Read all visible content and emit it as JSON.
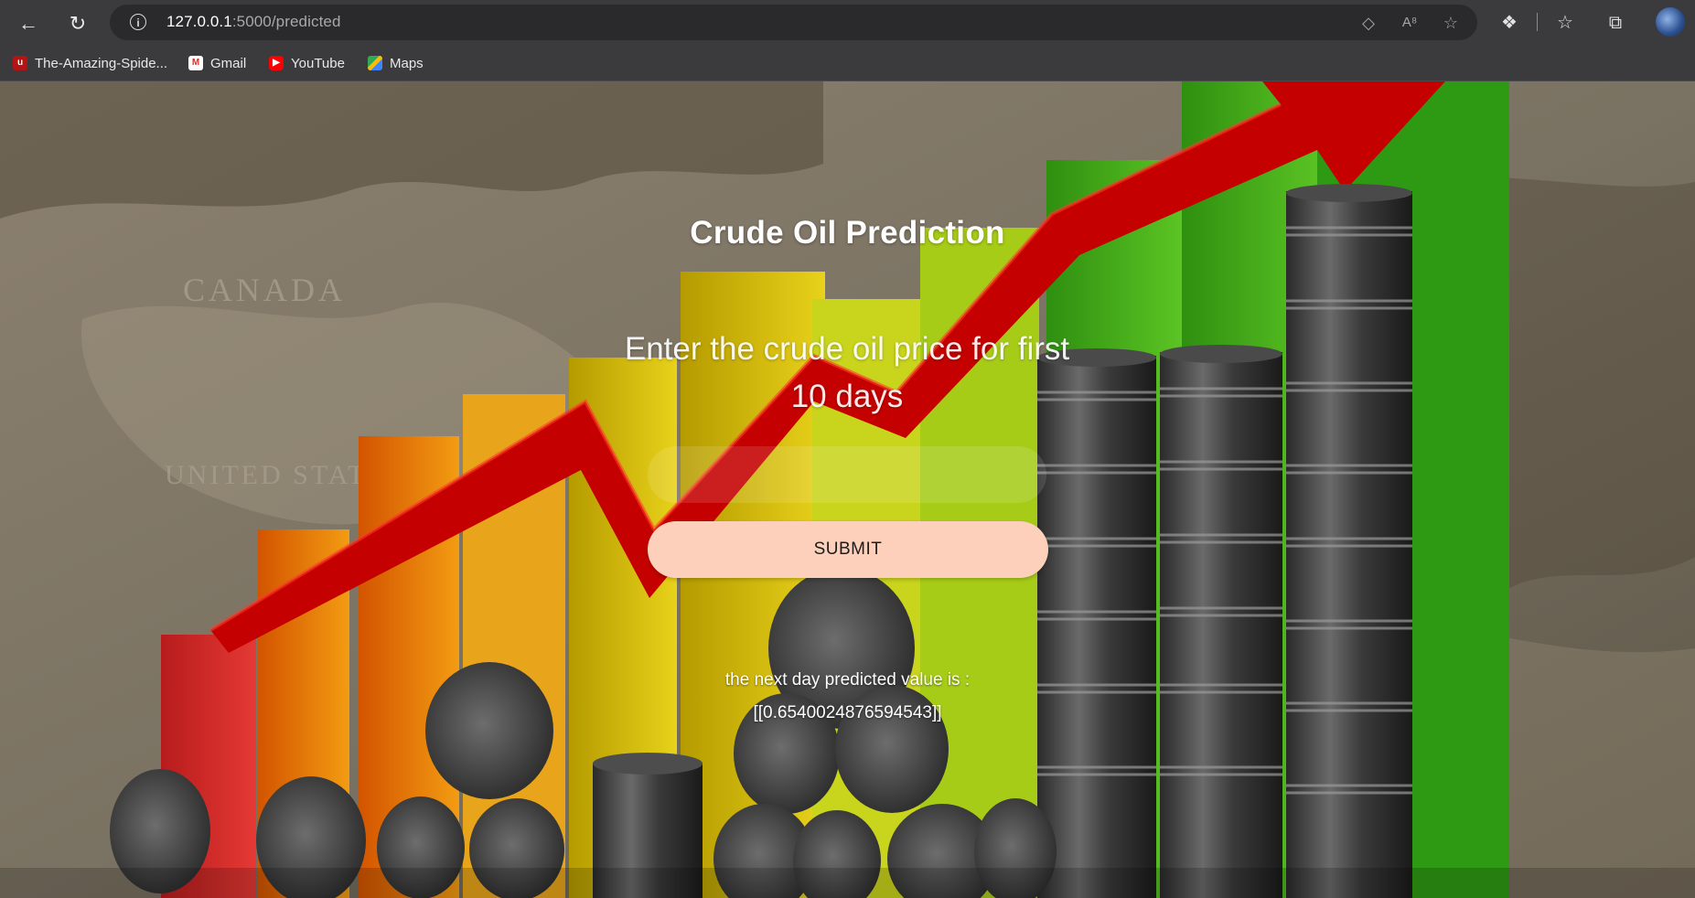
{
  "browser": {
    "url_host": "127.0.0.1",
    "url_path": ":5000/predicted",
    "bookmarks": [
      {
        "label": "The-Amazing-Spide...",
        "icon": "spiderman-favicon"
      },
      {
        "label": "Gmail",
        "icon": "gmail-favicon"
      },
      {
        "label": "YouTube",
        "icon": "youtube-favicon"
      },
      {
        "label": "Maps",
        "icon": "maps-favicon"
      }
    ]
  },
  "page": {
    "title": "Crude Oil Prediction",
    "prompt": "Enter the crude oil price for first 10 days",
    "input_value": "",
    "submit_label": "SUBMIT",
    "result_label": "the next day predicted value is :",
    "result_value": "[[0.6540024876594543]]"
  },
  "colors": {
    "submit_bg": "#fdd0bb",
    "chrome_bg": "#3b3b3d",
    "arrow": "#c10000"
  }
}
